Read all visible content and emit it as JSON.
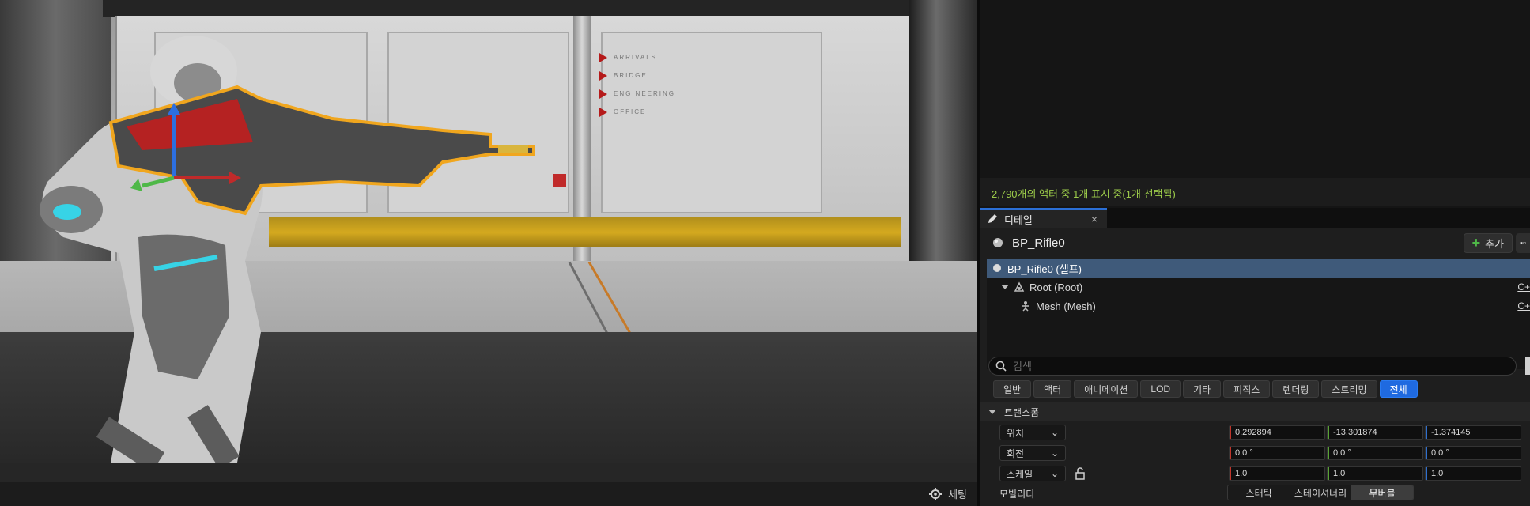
{
  "viewport": {
    "scene_signs": [
      "ARRIVALS",
      "BRIDGE",
      "ENGINEERING",
      "OFFICE"
    ],
    "settings_label": "세팅",
    "settings_icon": "gear-icon"
  },
  "outliner": {
    "status_text": "2,790개의 액터 중 1개 표시 중(1개 선택됨)",
    "status_color": "#9ccb4a"
  },
  "details": {
    "tab_label": "디테일",
    "tab_icon": "pencil-icon",
    "close_glyph": "×",
    "actor_name": "BP_Rifle0",
    "add_label": "추가",
    "extra_glyph": "▪▫",
    "components": [
      {
        "label": "BP_Rifle0 (셀프)",
        "selected": true
      },
      {
        "label": "Root (Root)",
        "right": "C+"
      },
      {
        "label": "Mesh (Mesh)",
        "right": "C+"
      }
    ],
    "search_placeholder": "검색",
    "filters": [
      "일반",
      "액터",
      "애니메이션",
      "LOD",
      "기타",
      "피직스",
      "렌더링",
      "스트리밍",
      "전체"
    ],
    "active_filter": "전체",
    "transform": {
      "title": "트랜스폼",
      "location": {
        "label": "위치",
        "x": "0.292894",
        "y": "-13.301874",
        "z": "-1.374145"
      },
      "rotation": {
        "label": "회전",
        "x": "0.0 °",
        "y": "0.0 °",
        "z": "0.0 °"
      },
      "scale": {
        "label": "스케일",
        "x": "1.0",
        "y": "1.0",
        "z": "1.0"
      },
      "mobility": {
        "label": "모빌리티",
        "options": [
          "스태틱",
          "스테이셔너리",
          "무버블"
        ],
        "active": "무버블"
      }
    },
    "accent": "#1f6ae0",
    "selection_color": "#3f5a7a"
  }
}
